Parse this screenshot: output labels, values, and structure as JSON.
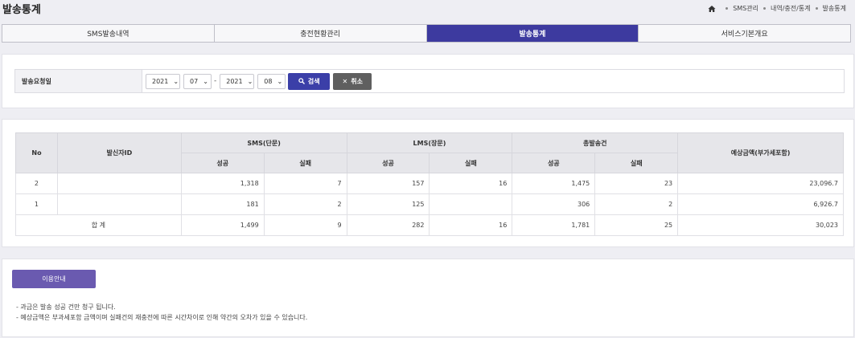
{
  "header": {
    "title": "발송통계",
    "breadcrumb": [
      "SMS관리",
      "내역/충전/통계",
      "발송통계"
    ]
  },
  "tabs": [
    {
      "label": "SMS발송내역",
      "active": false
    },
    {
      "label": "충전현황관리",
      "active": false
    },
    {
      "label": "발송통계",
      "active": true
    },
    {
      "label": "서비스기본개요",
      "active": false
    }
  ],
  "search": {
    "label": "발송요청일",
    "start_year": "2021",
    "start_month": "07",
    "separator": "-",
    "end_year": "2021",
    "end_month": "08",
    "search_label": "검색",
    "cancel_label": "취소"
  },
  "table": {
    "headers": {
      "no": "No",
      "sender": "발신자ID",
      "sms": "SMS(단문)",
      "lms": "LMS(장문)",
      "total": "총발송건",
      "amount": "예상금액(부가세포함)",
      "success": "성공",
      "fail": "실패"
    },
    "rows": [
      {
        "no": "2",
        "sender": "",
        "sms_s": "1,318",
        "sms_f": "7",
        "lms_s": "157",
        "lms_f": "16",
        "tot_s": "1,475",
        "tot_f": "23",
        "amount": "23,096.7"
      },
      {
        "no": "1",
        "sender": "",
        "sms_s": "181",
        "sms_f": "2",
        "lms_s": "125",
        "lms_f": "",
        "tot_s": "306",
        "tot_f": "2",
        "amount": "6,926.7"
      }
    ],
    "total": {
      "label": "합 계",
      "sms_s": "1,499",
      "sms_f": "9",
      "lms_s": "282",
      "lms_f": "16",
      "tot_s": "1,781",
      "tot_f": "25",
      "amount": "30,023"
    }
  },
  "info": {
    "button_label": "이용안내",
    "notes": [
      "- 과금은 발송 성공 건만 청구 됩니다.",
      "- 예상금액은 부과세포함 금액이며 실패건의 재충전에 따른 시간차이로 인해 약간의 오차가 있을 수 있습니다."
    ]
  },
  "colors": {
    "active_tab": "#3d3a9f",
    "search_button": "#3b3fa8",
    "cancel_button": "#5f5f5f",
    "guide_button": "#6a5ab0"
  }
}
